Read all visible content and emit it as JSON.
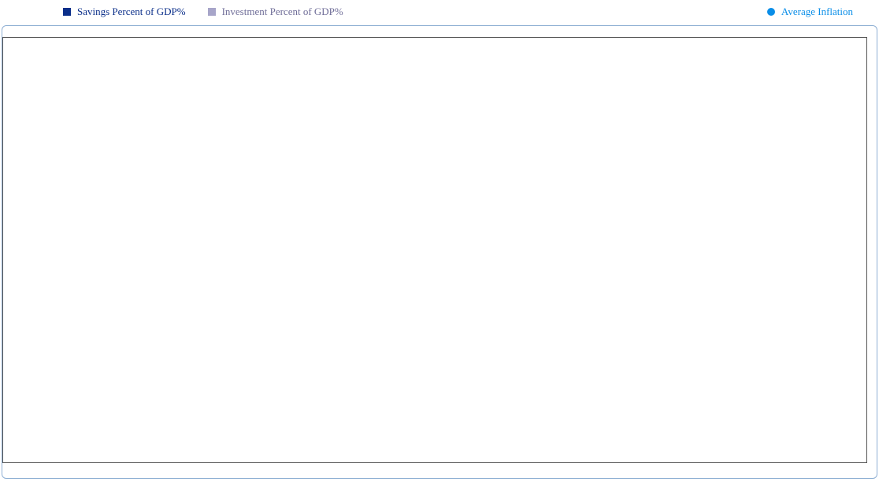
{
  "legend": {
    "items": [
      {
        "label": "Savings Percent of GDP%",
        "color": "#0b2f8a",
        "shape": "square"
      },
      {
        "label": "Investment Percent of GDP%",
        "color": "#a7a5c9",
        "shape": "square"
      }
    ],
    "secondary": {
      "label": "Average Inflation",
      "color": "#0a8ee8",
      "shape": "circle"
    }
  },
  "chart_data": {
    "type": "bar",
    "categories": [],
    "series": [
      {
        "name": "Savings Percent of GDP%",
        "values": []
      },
      {
        "name": "Investment Percent of GDP%",
        "values": []
      },
      {
        "name": "Average Inflation",
        "values": []
      }
    ],
    "legend_position": "top",
    "grid": false
  }
}
